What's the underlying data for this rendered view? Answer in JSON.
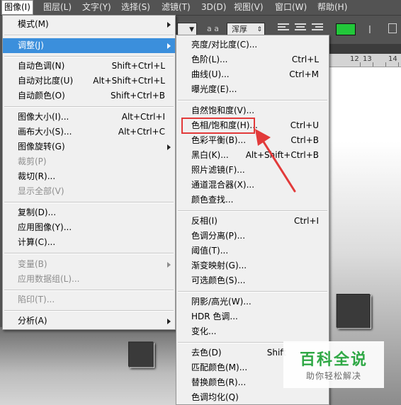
{
  "menubar": {
    "items": [
      "图像(I)",
      "图层(L)",
      "文字(Y)",
      "选择(S)",
      "滤镜(T)",
      "3D(D)",
      "视图(V)",
      "窗口(W)",
      "帮助(H)"
    ]
  },
  "options_bar": {
    "font_style_value": "浑厚",
    "aa_label": "a a",
    "text_color": "#22c73a"
  },
  "ruler": {
    "labels": [
      "12",
      "13",
      "14"
    ]
  },
  "image_menu": {
    "mode": "模式(M)",
    "adjust": "调整(J)",
    "auto_tone": "自动色调(N)",
    "auto_tone_sc": "Shift+Ctrl+L",
    "auto_contrast": "自动对比度(U)",
    "auto_contrast_sc": "Alt+Shift+Ctrl+L",
    "auto_color": "自动颜色(O)",
    "auto_color_sc": "Shift+Ctrl+B",
    "image_size": "图像大小(I)...",
    "image_size_sc": "Alt+Ctrl+I",
    "canvas_size": "画布大小(S)...",
    "canvas_size_sc": "Alt+Ctrl+C",
    "image_rotation": "图像旋转(G)",
    "crop": "裁剪(P)",
    "trim": "裁切(R)...",
    "reveal_all": "显示全部(V)",
    "duplicate": "复制(D)...",
    "apply_image": "应用图像(Y)...",
    "calculations": "计算(C)...",
    "variables": "变量(B)",
    "apply_dataset": "应用数据组(L)...",
    "trap": "陷印(T)...",
    "analysis": "分析(A)"
  },
  "adjust_menu": {
    "brightness_contrast": "亮度/对比度(C)...",
    "levels": "色阶(L)...",
    "levels_sc": "Ctrl+L",
    "curves": "曲线(U)...",
    "curves_sc": "Ctrl+M",
    "exposure": "曝光度(E)...",
    "vibrance": "自然饱和度(V)...",
    "hue_saturation": "色相/饱和度(H)...",
    "hue_saturation_sc": "Ctrl+U",
    "color_balance": "色彩平衡(B)...",
    "color_balance_sc": "Ctrl+B",
    "black_white": "黑白(K)...",
    "black_white_sc": "Alt+Shift+Ctrl+B",
    "photo_filter": "照片滤镜(F)...",
    "channel_mixer": "通道混合器(X)...",
    "color_lookup": "颜色查找...",
    "invert": "反相(I)",
    "invert_sc": "Ctrl+I",
    "posterize": "色调分离(P)...",
    "threshold": "阈值(T)...",
    "gradient_map": "渐变映射(G)...",
    "selective_color": "可选颜色(S)...",
    "shadows_highlights": "阴影/高光(W)...",
    "hdr_toning": "HDR 色调...",
    "variations": "变化...",
    "desaturate": "去色(D)",
    "desaturate_sc": "Shift",
    "match_color": "匹配颜色(M)...",
    "replace_color": "替换颜色(R)...",
    "equalize": "色调均化(Q)"
  },
  "watermark": {
    "title": "百科全说",
    "subtitle": "助你轻松解决"
  },
  "colors": {
    "highlight": "#3b8fdc",
    "annotation": "#e23a3a",
    "watermark_green": "#2fa845"
  }
}
